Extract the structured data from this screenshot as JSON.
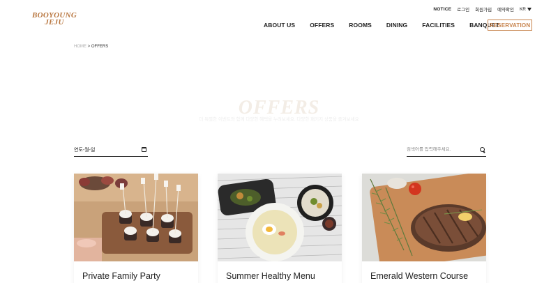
{
  "header": {
    "logo_line1": "BOOYOUNG",
    "logo_line2": "JEJU",
    "util": {
      "notice": "NOTICE",
      "login": "로그인",
      "signup": "회원가입",
      "booking_check": "예약확인",
      "lang": "KR"
    },
    "nav": [
      "ABOUT US",
      "OFFERS",
      "ROOMS",
      "DINING",
      "FACILITIES",
      "BANQUET"
    ],
    "reservation": "RESERVATION"
  },
  "breadcrumb": {
    "home": "HOME",
    "sep": ">",
    "current": "OFFERS"
  },
  "hero": {
    "title": "OFFERS",
    "subtitle": "더 특별한 이벤트와 함께 다양한 혜택을 누려보세요. 다양한 패키지 상품을 즐겨보세요"
  },
  "filters": {
    "date_value": "연도-월-일",
    "search_placeholder": "검색어를 입력해주세요."
  },
  "cards": [
    {
      "title": "Private Family Party"
    },
    {
      "title": "Summer Healthy Menu"
    },
    {
      "title": "Emerald Western Course"
    }
  ],
  "colors": {
    "accent": "#c7834c",
    "logo": "#b8763f"
  }
}
